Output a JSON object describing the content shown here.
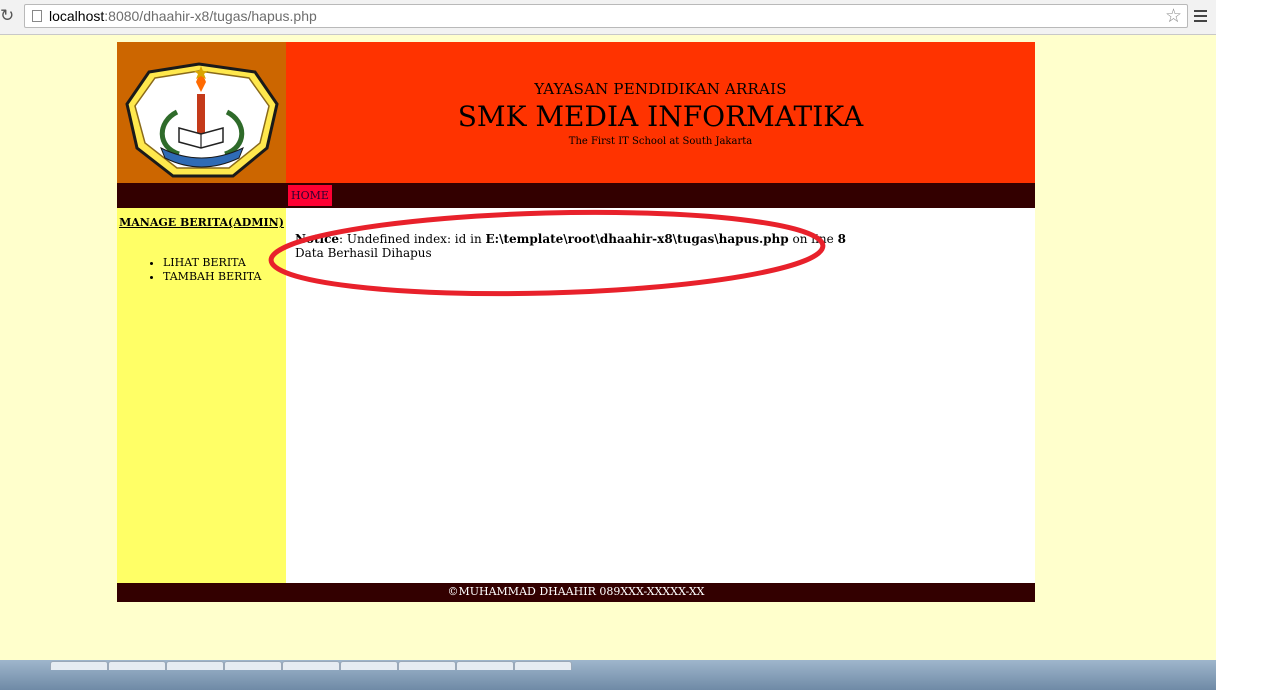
{
  "browser": {
    "url_host": "localhost",
    "url_path": ":8080/dhaahir-x8/tugas/hapus.php",
    "icons": {
      "reload": "reload-icon",
      "page": "page-icon",
      "bookmark": "star-icon",
      "menu": "menu-icon"
    }
  },
  "header": {
    "logo": {
      "arc_text": "SMK MEDIA INFORMATIKA",
      "city": "JAKARTA"
    },
    "foundation": "YAYASAN PENDIDIKAN ARRAIS",
    "school_name": "SMK MEDIA INFORMATIKA",
    "tagline": "The First IT School at South Jakarta"
  },
  "nav": {
    "items": [
      {
        "label": "HOME"
      }
    ]
  },
  "sidebar": {
    "title": "MANAGE BERITA(ADMIN)",
    "items": [
      {
        "label": "LIHAT BERITA"
      },
      {
        "label": "TAMBAH BERITA"
      }
    ]
  },
  "content": {
    "notice_label": "Notice",
    "notice_message": ": Undefined index: id in ",
    "notice_file": "E:\\template\\root\\dhaahir-x8\\tugas\\hapus.php",
    "notice_on_line": " on line ",
    "notice_line_number": "8",
    "result": "Data Berhasil Dihapus"
  },
  "footer": {
    "text": "©MUHAMMAD DHAAHIR 089XXX-XXXXX-XX"
  },
  "colors": {
    "page_background": "#ffffcc",
    "logo_background": "#cc6600",
    "header_background": "#ff3300",
    "nav_background": "#330000",
    "nav_active": "#ff0033",
    "sidebar_background": "#ffff66",
    "annotation": "#e8212b"
  }
}
